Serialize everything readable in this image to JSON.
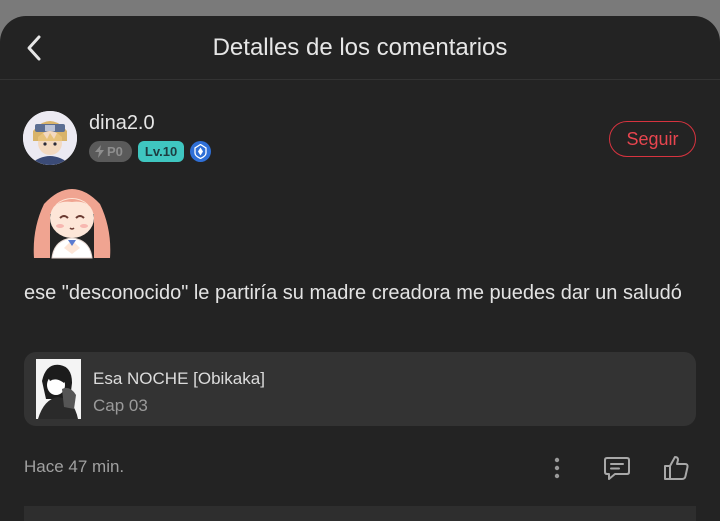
{
  "header": {
    "title": "Detalles de los comentarios"
  },
  "user": {
    "name": "dina2.0",
    "points_badge": "P0",
    "level_badge": "Lv.10",
    "follow_label": "Seguir"
  },
  "comment": {
    "text": "ese \"desconocido\" le partiría su madre creadora me puedes dar un saludó",
    "time": "Hace 47 min."
  },
  "reference": {
    "title": "Esa NOCHE [Obikaka]",
    "subtitle": "Cap 03"
  },
  "icons": {
    "back": "chevron-left-icon",
    "points": "lightning-icon",
    "verified": "shield-icon",
    "more": "more-vertical-icon",
    "reply": "comment-icon",
    "like": "thumbs-up-icon"
  },
  "colors": {
    "background": "#232323",
    "accent": "#e8454f",
    "level_badge": "#3fc6c0",
    "card": "#333333"
  }
}
